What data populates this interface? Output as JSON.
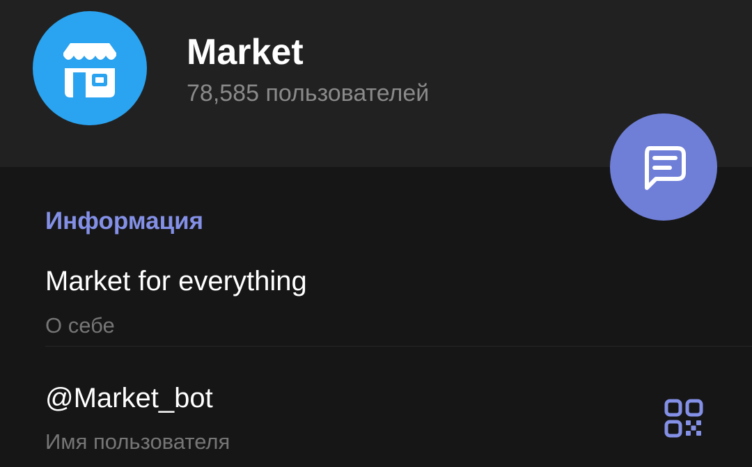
{
  "profile": {
    "name": "Market",
    "members": "78,585 пользователей",
    "avatar_icon": "storefront-icon",
    "avatar_color": "#2aa3f0"
  },
  "message_button": {
    "icon": "message-icon",
    "color": "#6f7fd8"
  },
  "info": {
    "section_title": "Информация",
    "about_value": "Market for everything",
    "about_label": "О себе",
    "username_value": "@Market_bot",
    "username_label": "Имя пользователя",
    "qr_icon": "qr-code-icon"
  },
  "colors": {
    "accent": "#8390e6",
    "background": "#161616",
    "header": "#212121"
  }
}
